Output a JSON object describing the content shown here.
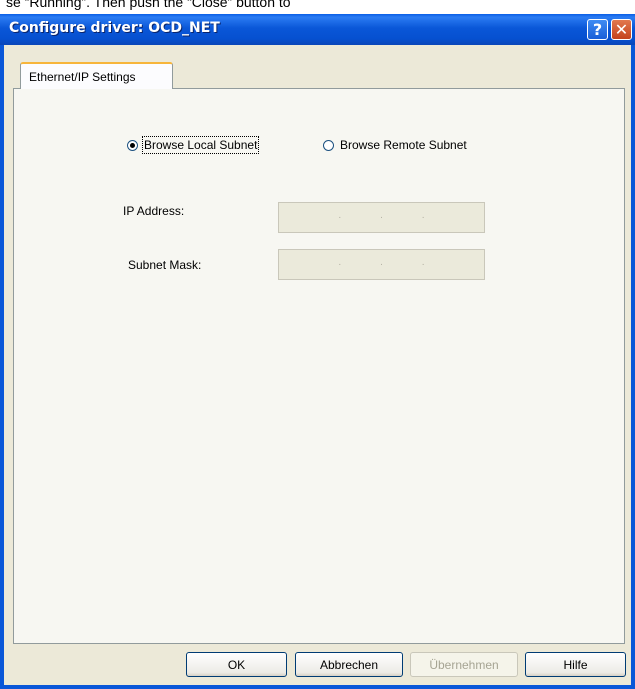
{
  "background_text": "se “Running”. Then push the “Close” button to",
  "window": {
    "title": "Configure driver: OCD_NET"
  },
  "titlebar": {
    "help_glyph": "?",
    "close_glyph": "✕"
  },
  "tabs": [
    {
      "label": "Ethernet/IP Settings",
      "active": true
    }
  ],
  "browse_mode": {
    "options": [
      {
        "label": "Browse Local Subnet",
        "selected": true
      },
      {
        "label": "Browse Remote Subnet",
        "selected": false
      }
    ]
  },
  "fields": {
    "ip_address": {
      "label": "IP Address:",
      "value": "   .   .   .   ",
      "enabled": false
    },
    "subnet_mask": {
      "label": "Subnet Mask:",
      "value": "   .   .   .   ",
      "enabled": false
    }
  },
  "buttons": {
    "ok": "OK",
    "cancel": "Abbrechen",
    "apply": "Übernehmen",
    "help": "Hilfe"
  },
  "colors": {
    "titlebar": "#0a57d8",
    "dialog_face": "#ece9d8",
    "tab_accent": "#f7b53a",
    "close_button": "#c4421c"
  }
}
